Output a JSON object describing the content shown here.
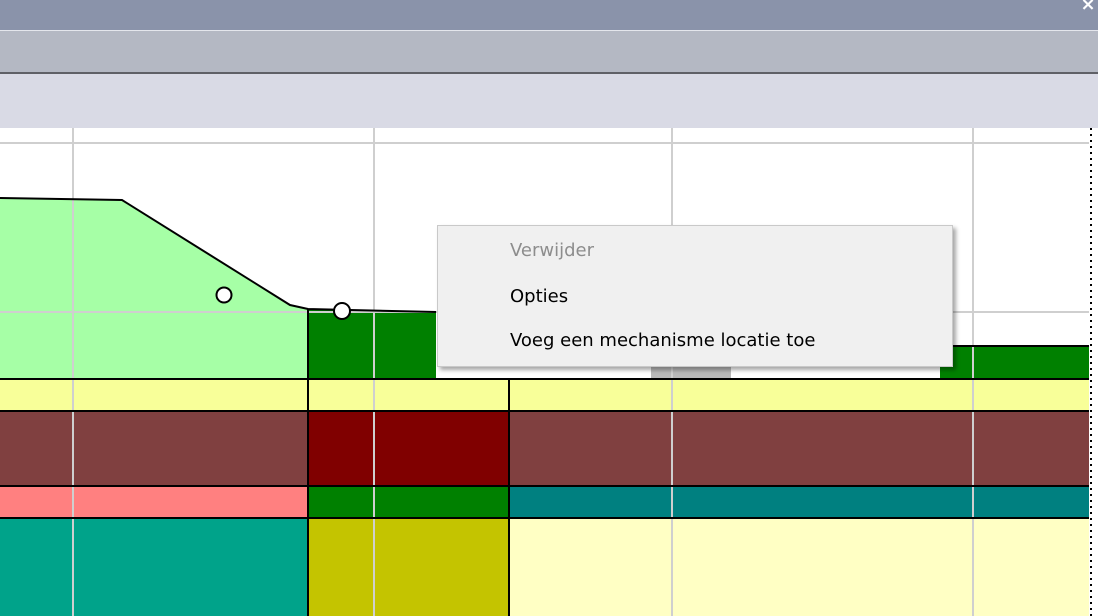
{
  "window": {
    "close_glyph": "×"
  },
  "colors": {
    "titlebar": "#8a93aa",
    "toolbar": "#b4b8c3",
    "ribbon": "#d9dae5",
    "grid": "#cfcfcf",
    "dike_body": "#a6ffa6",
    "green_layer": "#008000",
    "pale_yellow_layer": "#f8ff99",
    "brown_layer": "#804040",
    "dark_red_layer": "#800000",
    "salmon_layer": "#ff8080",
    "teal_layer": "#008080",
    "sea_green_layer": "#00a38a",
    "olive_layer": "#c4c400",
    "light_yellow_layer": "#ffffc4"
  },
  "context_menu": {
    "items": [
      {
        "label": "Verwijder",
        "enabled": false
      },
      {
        "label": "Opties",
        "enabled": true
      },
      {
        "label": "Voeg een mechanisme locatie toe",
        "enabled": true
      }
    ]
  }
}
